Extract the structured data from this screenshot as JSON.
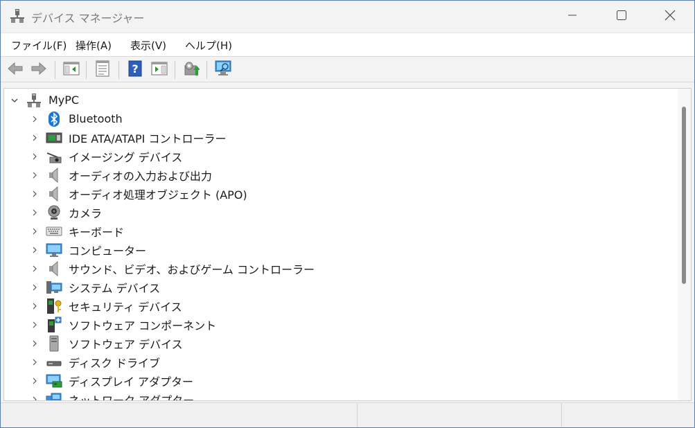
{
  "window": {
    "title": "デバイス マネージャー",
    "icon": "device-manager-icon"
  },
  "controls": {
    "minimize": "minimize-icon",
    "maximize": "maximize-icon",
    "close": "close-icon"
  },
  "menu": [
    {
      "label": "ファイル(F)"
    },
    {
      "label": "操作(A)"
    },
    {
      "label": "表示(V)"
    },
    {
      "label": "ヘルプ(H)"
    }
  ],
  "toolbar": [
    {
      "icon": "back-arrow-icon"
    },
    {
      "icon": "forward-arrow-icon"
    },
    {
      "icon": "show-hide-console-tree-icon"
    },
    {
      "icon": "properties-icon"
    },
    {
      "icon": "help-icon"
    },
    {
      "icon": "action-pane-icon"
    },
    {
      "icon": "update-driver-icon"
    },
    {
      "icon": "scan-hardware-changes-icon"
    }
  ],
  "tree": {
    "root": {
      "label": "MyPC",
      "icon": "computer-tower-icon",
      "expanded": true
    },
    "children": [
      {
        "label": "Bluetooth",
        "icon": "bluetooth-icon"
      },
      {
        "label": "IDE ATA/ATAPI コントローラー",
        "icon": "ide-controller-icon"
      },
      {
        "label": "イメージング デバイス",
        "icon": "imaging-device-icon"
      },
      {
        "label": "オーディオの入力および出力",
        "icon": "speaker-icon"
      },
      {
        "label": "オーディオ処理オブジェクト (APO)",
        "icon": "speaker-icon"
      },
      {
        "label": "カメラ",
        "icon": "webcam-icon"
      },
      {
        "label": "キーボード",
        "icon": "keyboard-icon"
      },
      {
        "label": "コンピューター",
        "icon": "monitor-icon"
      },
      {
        "label": "サウンド、ビデオ、およびゲーム コントローラー",
        "icon": "speaker-icon"
      },
      {
        "label": "システム デバイス",
        "icon": "system-device-icon"
      },
      {
        "label": "セキュリティ デバイス",
        "icon": "security-key-icon"
      },
      {
        "label": "ソフトウェア コンポーネント",
        "icon": "software-component-icon"
      },
      {
        "label": "ソフトウェア デバイス",
        "icon": "software-device-icon"
      },
      {
        "label": "ディスク ドライブ",
        "icon": "disk-drive-icon"
      },
      {
        "label": "ディスプレイ アダプター",
        "icon": "display-adapter-icon"
      },
      {
        "label": "ネットワーク アダプター",
        "icon": "network-adapter-icon"
      }
    ]
  }
}
